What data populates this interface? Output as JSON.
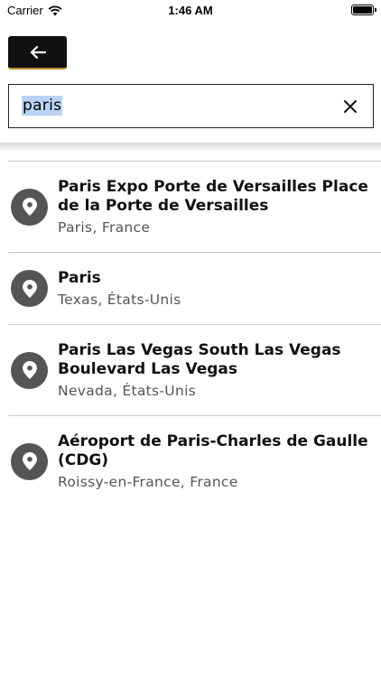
{
  "status_bar": {
    "carrier": "Carrier",
    "time": "1:46 AM"
  },
  "search": {
    "query": "paris"
  },
  "results": [
    {
      "title": "Paris Expo Porte de Versailles Place de la Porte de Versailles",
      "subtitle": "Paris, France"
    },
    {
      "title": "Paris",
      "subtitle": "Texas, États-Unis"
    },
    {
      "title": "Paris Las Vegas South Las Vegas Boulevard Las Vegas",
      "subtitle": "Nevada, États-Unis"
    },
    {
      "title": "Aéroport de Paris-Charles de Gaulle (CDG)",
      "subtitle": "Roissy-en-France, France"
    }
  ]
}
